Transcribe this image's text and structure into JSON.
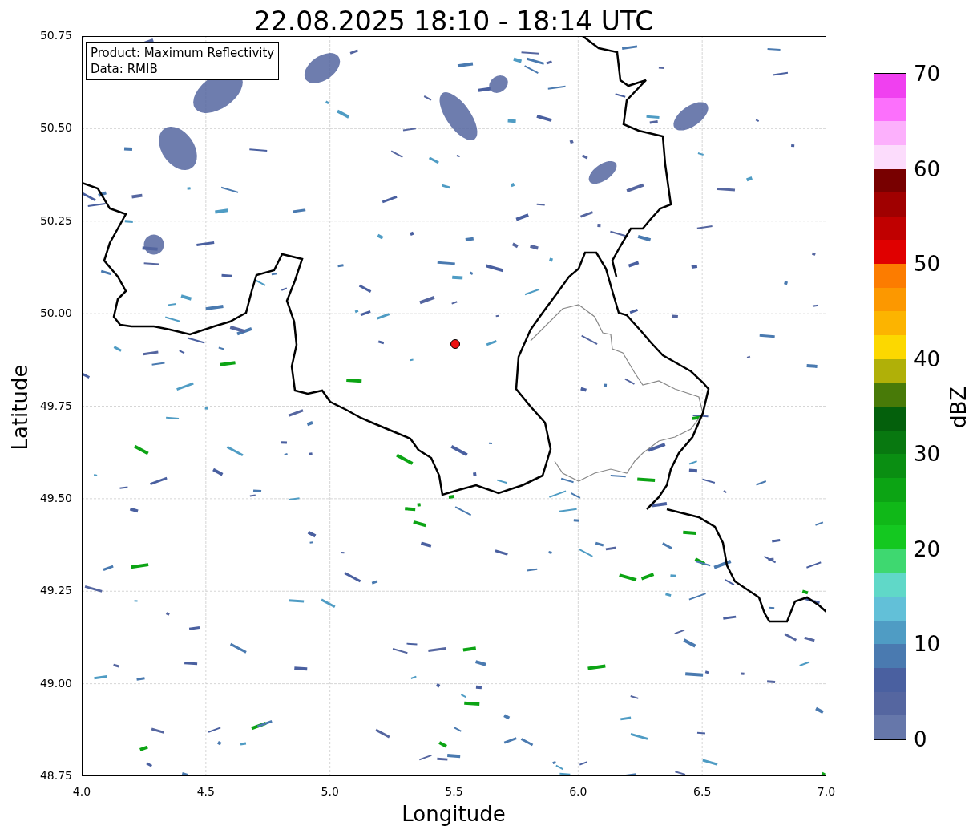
{
  "title": "22.08.2025 18:10 - 18:14 UTC",
  "legend": {
    "lines": [
      "Product: Maximum Reflectivity",
      "Data: RMIB"
    ]
  },
  "x_axis": {
    "label": "Longitude",
    "ticks": [
      "4.0",
      "4.5",
      "5.0",
      "5.5",
      "6.0",
      "6.5",
      "7.0"
    ]
  },
  "y_axis": {
    "label": "Latitude",
    "ticks": [
      "50.75",
      "50.50",
      "50.25",
      "50.00",
      "49.75",
      "49.50",
      "49.25",
      "49.00",
      "48.75"
    ]
  },
  "colorbar": {
    "label": "dBZ",
    "ticks": [
      "70",
      "60",
      "50",
      "40",
      "30",
      "20",
      "10",
      "0"
    ],
    "segments": [
      {
        "color": "#f040f0"
      },
      {
        "color": "#fc70fc"
      },
      {
        "color": "#fcb0fc"
      },
      {
        "color": "#fcdcfc"
      },
      {
        "color": "#780000"
      },
      {
        "color": "#a00000"
      },
      {
        "color": "#c00000"
      },
      {
        "color": "#e00000"
      },
      {
        "color": "#fc7c00"
      },
      {
        "color": "#fc9800"
      },
      {
        "color": "#fcb400"
      },
      {
        "color": "#fcd800"
      },
      {
        "color": "#b0b008"
      },
      {
        "color": "#487a08"
      },
      {
        "color": "#04600c"
      },
      {
        "color": "#087810"
      },
      {
        "color": "#0a8e12"
      },
      {
        "color": "#0ca414"
      },
      {
        "color": "#10b818"
      },
      {
        "color": "#14c820"
      },
      {
        "color": "#3ed870"
      },
      {
        "color": "#60d8c8"
      },
      {
        "color": "#62c0d8"
      },
      {
        "color": "#4f9cc4"
      },
      {
        "color": "#4a7ab0"
      },
      {
        "color": "#4a60a0"
      },
      {
        "color": "#5566a0"
      },
      {
        "color": "#6677aa"
      }
    ]
  }
}
